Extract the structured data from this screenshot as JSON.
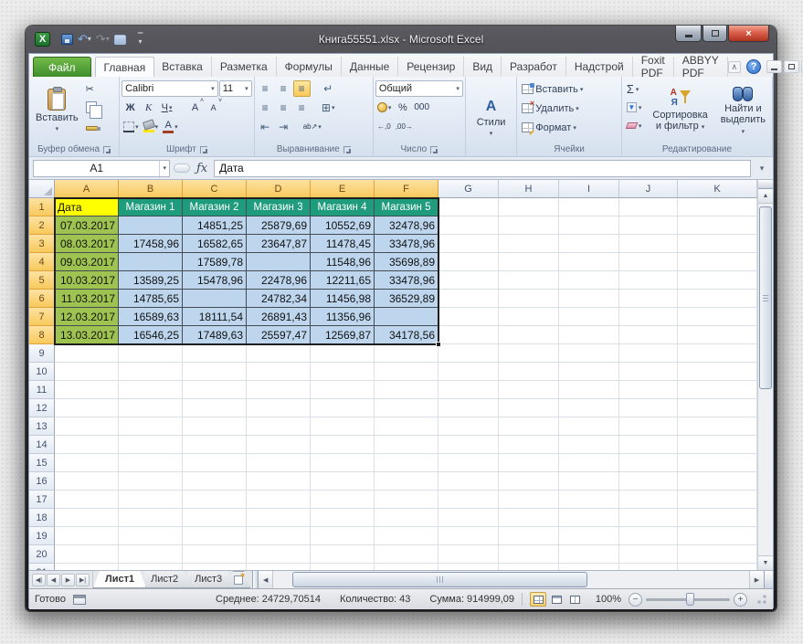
{
  "window": {
    "title": "Книга55551.xlsx  -  Microsoft Excel"
  },
  "colors": {
    "mag_header_fill": "#1f9c7c",
    "date_fill": "#9fc350",
    "title_cell_fill": "#ffff00",
    "data_fill": "#bdd6ee",
    "selected_header": "#f8c95c",
    "file_tab_green": "#3f8d2d"
  },
  "icons": {
    "excel_logo": "X",
    "undo": "↶",
    "redo": "↷",
    "dropdown": "▾",
    "qat_more": "▾",
    "minimize_glyph": "",
    "close_glyph": "×",
    "ribbon_collapse": "∧",
    "help": "?",
    "fx": "ƒx",
    "scissors": "✂",
    "sum": "Σ",
    "up_arrow": "▲",
    "down_arrow": "▼",
    "left_arrow": "◀",
    "right_arrow": "▶",
    "first": "◀|",
    "prev": "◀",
    "next": "▶",
    "last": "▶|",
    "align_lines": "≡",
    "wrap": "↵",
    "merge": "⊞",
    "orient": "ab↗",
    "indent_less": "⇤",
    "indent_more": "⇥",
    "fill_down": "▼",
    "minus": "−",
    "plus": "+"
  },
  "ribbon_tabs": {
    "file": "Файл",
    "items": [
      {
        "label": "Главная",
        "active": true
      },
      {
        "label": "Вставка"
      },
      {
        "label": "Разметка"
      },
      {
        "label": "Формулы"
      },
      {
        "label": "Данные"
      },
      {
        "label": "Рецензир"
      },
      {
        "label": "Вид"
      },
      {
        "label": "Разработ"
      },
      {
        "label": "Надстрой"
      },
      {
        "label": "Foxit PDF"
      },
      {
        "label": "ABBYY PDF"
      }
    ]
  },
  "ribbon": {
    "clipboard": {
      "paste": "Вставить",
      "label": "Буфер обмена"
    },
    "font": {
      "name": "Calibri",
      "size": "11",
      "bold": "Ж",
      "italic": "К",
      "underline": "Ч",
      "grow": "А",
      "shrink": "А",
      "color_letter": "А",
      "label": "Шрифт"
    },
    "alignment": {
      "label": "Выравнивание"
    },
    "number": {
      "format": "Общий",
      "percent": "%",
      "thousands": "000",
      "dec_inc": "←,0",
      "dec_dec": ",00→",
      "label": "Число"
    },
    "styles": {
      "letter": "А",
      "label": "Стили"
    },
    "cells": {
      "insert": "Вставить",
      "delete": "Удалить",
      "format": "Формат",
      "label": "Ячейки"
    },
    "editing": {
      "sort_l1": "Сортировка",
      "sort_l2": "и фильтр",
      "find_l1": "Найти и",
      "find_l2": "выделить",
      "label": "Редактирование"
    }
  },
  "formula_bar": {
    "name_box": "A1",
    "content": "Дата"
  },
  "sheet": {
    "columns": [
      "A",
      "B",
      "C",
      "D",
      "E",
      "F",
      "G",
      "H",
      "I",
      "J",
      "K"
    ],
    "selected_columns": [
      "A",
      "B",
      "C",
      "D",
      "E",
      "F"
    ],
    "selected_rows_count": 8,
    "visible_rows": 21,
    "table": {
      "header": [
        "Дата",
        "Магазин 1",
        "Магазин 2",
        "Магазин 3",
        "Магазин 4",
        "Магазин 5"
      ],
      "rows": [
        [
          "07.03.2017",
          "",
          "14851,25",
          "25879,69",
          "10552,69",
          "32478,96"
        ],
        [
          "08.03.2017",
          "17458,96",
          "16582,65",
          "23647,87",
          "11478,45",
          "33478,96"
        ],
        [
          "09.03.2017",
          "",
          "17589,78",
          "",
          "11548,96",
          "35698,89"
        ],
        [
          "10.03.2017",
          "13589,25",
          "15478,96",
          "22478,96",
          "12211,65",
          "33478,96"
        ],
        [
          "11.03.2017",
          "14785,65",
          "",
          "24782,34",
          "11456,98",
          "36529,89"
        ],
        [
          "12.03.2017",
          "16589,63",
          "18111,54",
          "26891,43",
          "11356,96",
          ""
        ],
        [
          "13.03.2017",
          "16546,25",
          "17489,63",
          "25597,47",
          "12569,87",
          "34178,56"
        ]
      ]
    }
  },
  "sheet_tabs": {
    "items": [
      {
        "label": "Лист1",
        "active": true
      },
      {
        "label": "Лист2"
      },
      {
        "label": "Лист3"
      }
    ]
  },
  "status_bar": {
    "ready": "Готово",
    "stats": [
      {
        "label": "Среднее:",
        "value": "24729,70514"
      },
      {
        "label": "Количество:",
        "value": "43"
      },
      {
        "label": "Сумма:",
        "value": "914999,09"
      }
    ],
    "zoom": "100%"
  }
}
